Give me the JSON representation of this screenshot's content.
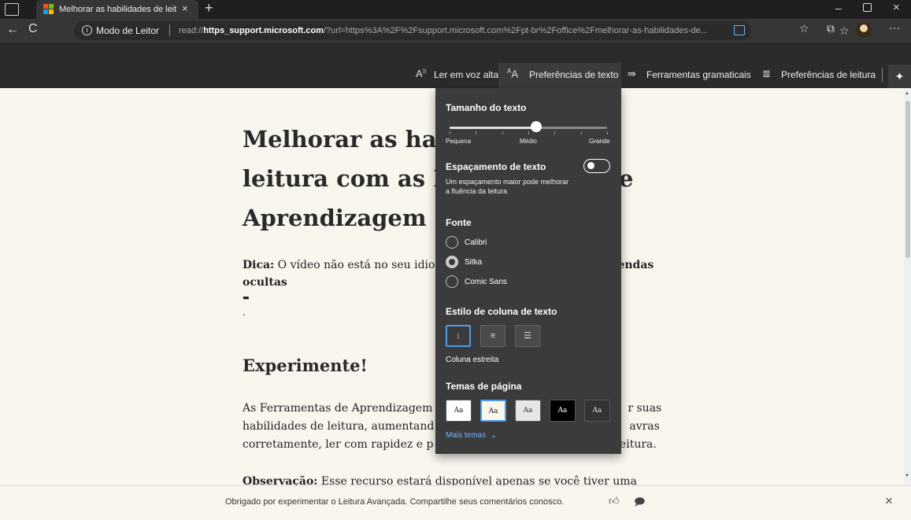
{
  "window": {
    "tab_title": "Melhorar as habilidades de leitura",
    "tab_close": "×",
    "new_tab": "+",
    "minimize": "–",
    "close": "×"
  },
  "nav": {
    "back": "←",
    "refresh": "C",
    "reader_mode_label": "Modo de Leitor",
    "url_prefix": "read://",
    "url_host": "https_support.microsoft.com",
    "url_rest": "/?url=https%3A%2F%2Fsupport.microsoft.com%2Fpt-br%2Foffice%2Fmelhorar-as-habilidades-de...",
    "more": "···"
  },
  "reader_toolbar": {
    "read_aloud": "Ler em voz alta",
    "text_prefs": "Preferências de texto",
    "grammar_tools": "Ferramentas gramaticais",
    "reading_prefs": "Preferências de leitura"
  },
  "article": {
    "title": "Melhorar as habilidades de leitura com as Ferramentas de Aprendizagem",
    "tip_label": "Dica:",
    "tip_text_start": " O vídeo não está no seu idio",
    "tip_text_end": "endas",
    "tip_bold_line2": "ocultas",
    "tip_dot": ".",
    "section_heading": "Experimente!",
    "para_line1_a": "As Ferramentas de Aprendizagem",
    "para_line1_b": "r suas",
    "para_line2_a": "habilidades de leitura, aumentand",
    "para_line2_b": "avras",
    "para_line3_a": "corretamente, ler com rapidez e p",
    "para_line3_b": "leitura.",
    "obs_label": "Observação:",
    "obs_text": " Esse recurso estará disponível apenas se você tiver uma"
  },
  "feedback": {
    "text": "Obrigado por experimentar o Leitura Avançada. Compartilhe seus comentários conosco.",
    "close": "×"
  },
  "panel": {
    "text_size": {
      "heading": "Tamanho do texto",
      "value_fraction": 0.55,
      "labels": [
        "Pequena",
        "Médio",
        "Grande"
      ]
    },
    "spacing": {
      "heading": "Espaçamento de texto",
      "enabled": false,
      "description": "Um espaçamento maior pode melhorar a fluência da leitura"
    },
    "font": {
      "heading": "Fonte",
      "options": [
        "Calibri",
        "Sitka",
        "Comic Sans"
      ],
      "selected": "Sitka"
    },
    "columns": {
      "heading": "Estilo de coluna de texto",
      "caption": "Coluna estreita",
      "selected_index": 0
    },
    "themes": {
      "heading": "Temas de página",
      "sample": "Aa",
      "swatches": [
        {
          "bg": "#ffffff",
          "fg": "#222222"
        },
        {
          "bg": "#f9f6ee",
          "fg": "#222222"
        },
        {
          "bg": "#e6e6e6",
          "fg": "#333333"
        },
        {
          "bg": "#000000",
          "fg": "#ffffff"
        },
        {
          "bg": "#333333",
          "fg": "#dddddd"
        }
      ],
      "selected_index": 1,
      "more": "Mais temas"
    }
  },
  "colors": {
    "accent": "#4a9ee8",
    "page_bg": "#f9f6ee",
    "panel_bg": "#3b3b3b"
  }
}
